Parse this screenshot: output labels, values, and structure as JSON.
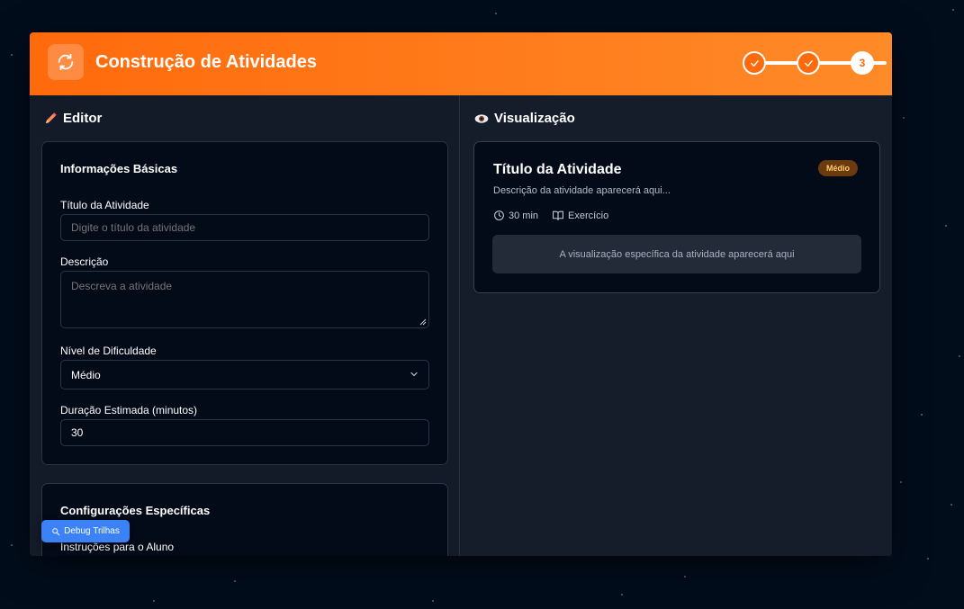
{
  "header": {
    "title": "Construção de Atividades",
    "steps": [
      {
        "state": "done",
        "icon": "check-icon"
      },
      {
        "state": "done",
        "icon": "check-icon"
      },
      {
        "state": "current",
        "label": "3"
      }
    ],
    "accent": "#ff7a1a"
  },
  "editor": {
    "heading": "Editor",
    "basic_info": {
      "title": "Informações Básicas",
      "activity_title": {
        "label": "Título da Atividade",
        "placeholder": "Digite o título da atividade",
        "value": ""
      },
      "description": {
        "label": "Descrição",
        "placeholder": "Descreva a atividade",
        "value": ""
      },
      "difficulty": {
        "label": "Nível de Dificuldade",
        "value": "Médio"
      },
      "duration": {
        "label": "Duração Estimada (minutos)",
        "value": "30"
      }
    },
    "specific_config": {
      "title": "Configurações Específicas",
      "instructions_label": "Instruções para o Aluno"
    }
  },
  "preview": {
    "heading": "Visualização",
    "card": {
      "title": "Título da Atividade",
      "badge": "Médio",
      "description": "Descrição da atividade aparecerá aqui...",
      "duration": "30 min",
      "type": "Exercício",
      "placeholder": "A visualização específica da atividade aparecerá aqui"
    }
  },
  "debug_button": {
    "label": "Debug Trilhas",
    "color": "#3b82f6"
  }
}
